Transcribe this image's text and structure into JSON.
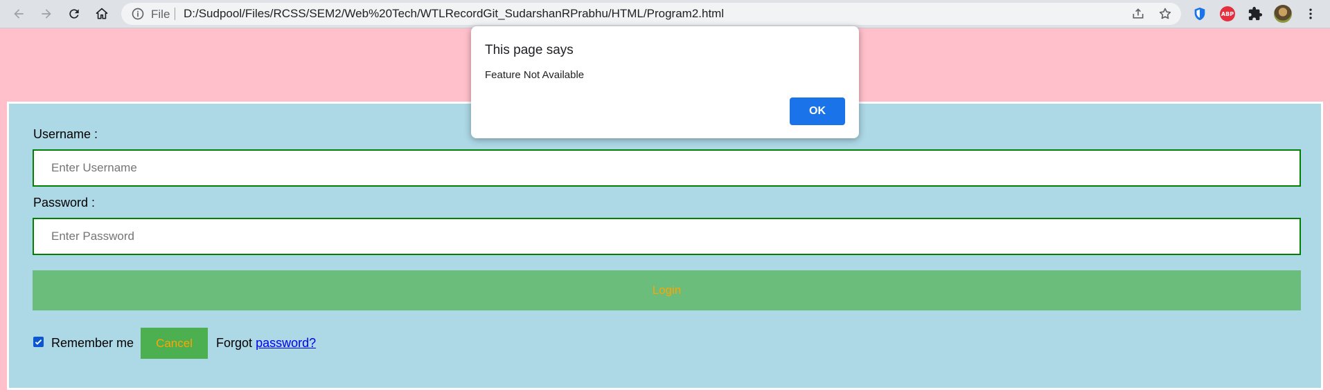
{
  "browser": {
    "scheme_label": "File",
    "url": "D:/Sudpool/Files/RCSS/SEM2/Web%20Tech/WTLRecordGit_SudarshanRPrabhu/HTML/Program2.html",
    "abp_label": "ABP",
    "icons": [
      "back-icon",
      "forward-icon",
      "reload-icon",
      "home-icon",
      "info-icon",
      "share-icon",
      "star-icon",
      "shield-icon",
      "abp-icon",
      "puzzle-icon",
      "avatar",
      "kebab-menu-icon"
    ]
  },
  "form": {
    "username_label": "Username :",
    "username_placeholder": "Enter Username",
    "password_label": "Password :",
    "password_placeholder": "Enter Password",
    "login_label": "Login",
    "remember_label": "Remember me",
    "remember_checked": true,
    "cancel_label": "Cancel",
    "forgot_text": "Forgot",
    "forgot_link": "password?"
  },
  "dialog": {
    "title": "This page says",
    "message": "Feature Not Available",
    "ok_label": "OK"
  },
  "colors": {
    "page_bg": "#ffc0cb",
    "form_bg": "#add8e6",
    "input_border": "#008000",
    "login_bg": "#6abd7b",
    "button_text": "#ffa500",
    "cancel_bg": "#4caf50",
    "dialog_ok_bg": "#1a73e8"
  }
}
